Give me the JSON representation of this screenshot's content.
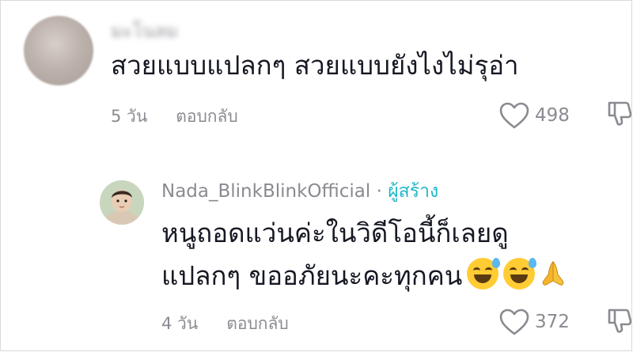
{
  "comments": [
    {
      "username": "มะโนลม",
      "text": "สวยแบบแปลกๆ สวยแบบยังไงไม่รุอ่า",
      "age": "5 วัน",
      "reply_label": "ตอบกลับ",
      "likes": "498",
      "avatar_icon": "avatar-blurred",
      "username_blurred": true
    },
    {
      "username": "Nada_BlinkBlinkOfficial",
      "separator": " · ",
      "creator_badge": "ผู้สร้าง",
      "text_line1": "หนูถอดแว่นค่ะในวิดีโอนี้ก็เลยดู",
      "text_line2": "แปลกๆ ขออภัยนะคะทุกคน",
      "emojis": [
        "sweat-smile-emoji",
        "sweat-smile-emoji",
        "folded-hands-emoji"
      ],
      "age": "4 วัน",
      "reply_label": "ตอบกลับ",
      "likes": "372",
      "avatar_icon": "avatar-baby-photo"
    }
  ],
  "colors": {
    "text": "#161823",
    "meta": "#8a8b91",
    "creator": "#20b8c8",
    "emoji": "#ffcc33"
  }
}
